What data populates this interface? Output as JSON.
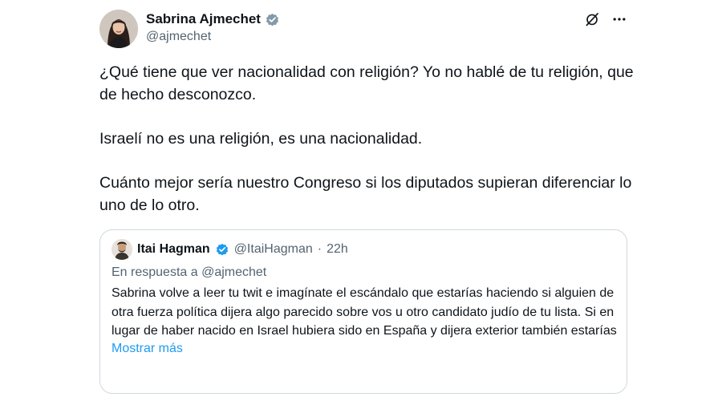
{
  "author": {
    "display_name": "Sabrina Ajmechet",
    "handle": "@ajmechet",
    "verified": true,
    "verified_color": "#829aab"
  },
  "actions": {
    "grok_icon": "grok-icon",
    "more_icon": "more-icon"
  },
  "tweet": {
    "paragraphs": [
      "¿Qué tiene que ver nacionalidad con religión? Yo no hablé de tu religión, que de hecho desconozco.",
      "Israelí no es una religión, es una nacionalidad.",
      "Cuánto mejor sería nuestro Congreso si los diputados supieran diferenciar lo uno de lo otro."
    ]
  },
  "quote": {
    "display_name": "Itai Hagman",
    "handle": "@ItaiHagman",
    "separator": "·",
    "time": "22h",
    "verified": true,
    "verified_color": "#1d9bf0",
    "reply_prefix": "En respuesta a",
    "reply_to": "@ajmechet",
    "text": "Sabrina volve a leer tu twit e imagínate el escándalo que estarías haciendo si alguien de otra fuerza política dijera algo parecido sobre vos u otro candidato judío de tu lista. Si en lugar de haber nacido en Israel hubiera sido en España y dijera exterior también estarías",
    "show_more": "Mostrar más",
    "link_color": "#1d9bf0"
  },
  "colors": {
    "text_primary": "#0f1419",
    "text_secondary": "#536471",
    "border": "#cfd9de"
  }
}
